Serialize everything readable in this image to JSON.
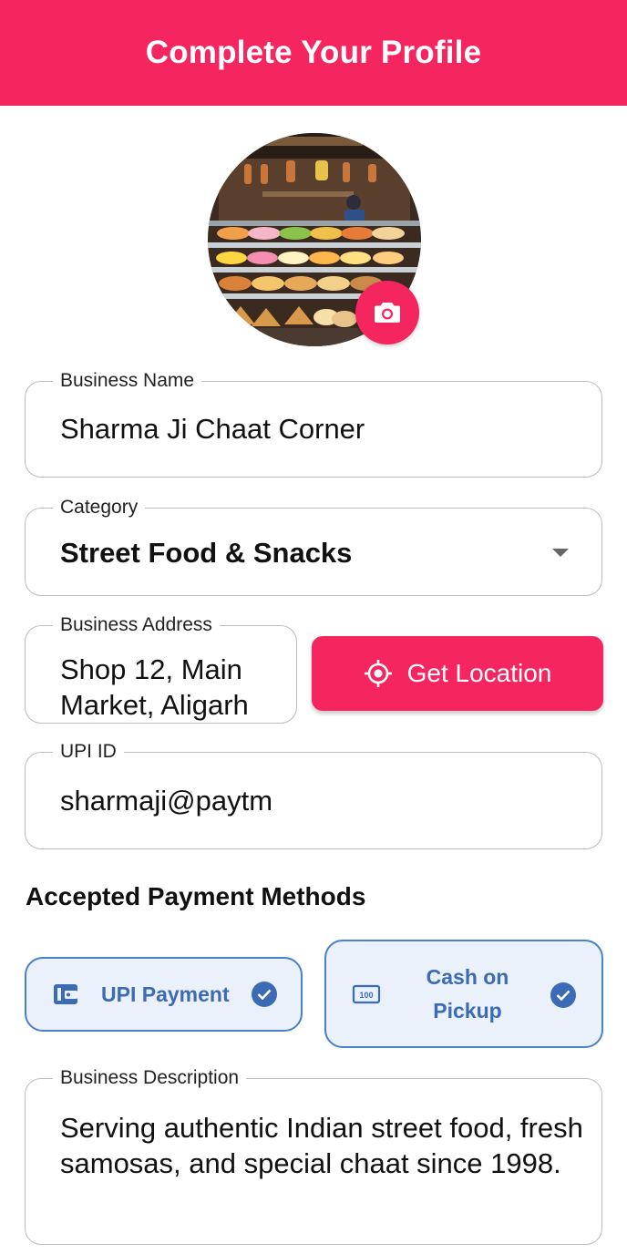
{
  "header": {
    "title": "Complete Your Profile"
  },
  "colors": {
    "primary": "#f5255f",
    "accent_blue": "#3b6bb5",
    "card_bg": "#eaf1fb"
  },
  "profile": {
    "avatar_icon": "shop-photo",
    "camera_icon": "camera-icon"
  },
  "form": {
    "business_name": {
      "label": "Business Name",
      "value": "Sharma Ji Chaat Corner"
    },
    "category": {
      "label": "Category",
      "value": "Street Food & Snacks",
      "icon": "chevron-down-icon"
    },
    "business_address": {
      "label": "Business Address",
      "value": "Shop 12, Main Market, Aligarh"
    },
    "get_location": {
      "label": "Get Location",
      "icon": "gps-target-icon"
    },
    "upi_id": {
      "label": "UPI ID",
      "value": "sharmaji@paytm"
    },
    "business_description": {
      "label": "Business Description",
      "value": "Serving authentic Indian street food, fresh samosas, and special chaat since 1998."
    }
  },
  "payments": {
    "title": "Accepted Payment Methods",
    "methods": [
      {
        "label": "UPI Payment",
        "icon": "wallet-icon",
        "selected": true
      },
      {
        "label": "Cash on Pickup",
        "icon": "cash-note-icon",
        "selected": true
      }
    ]
  }
}
